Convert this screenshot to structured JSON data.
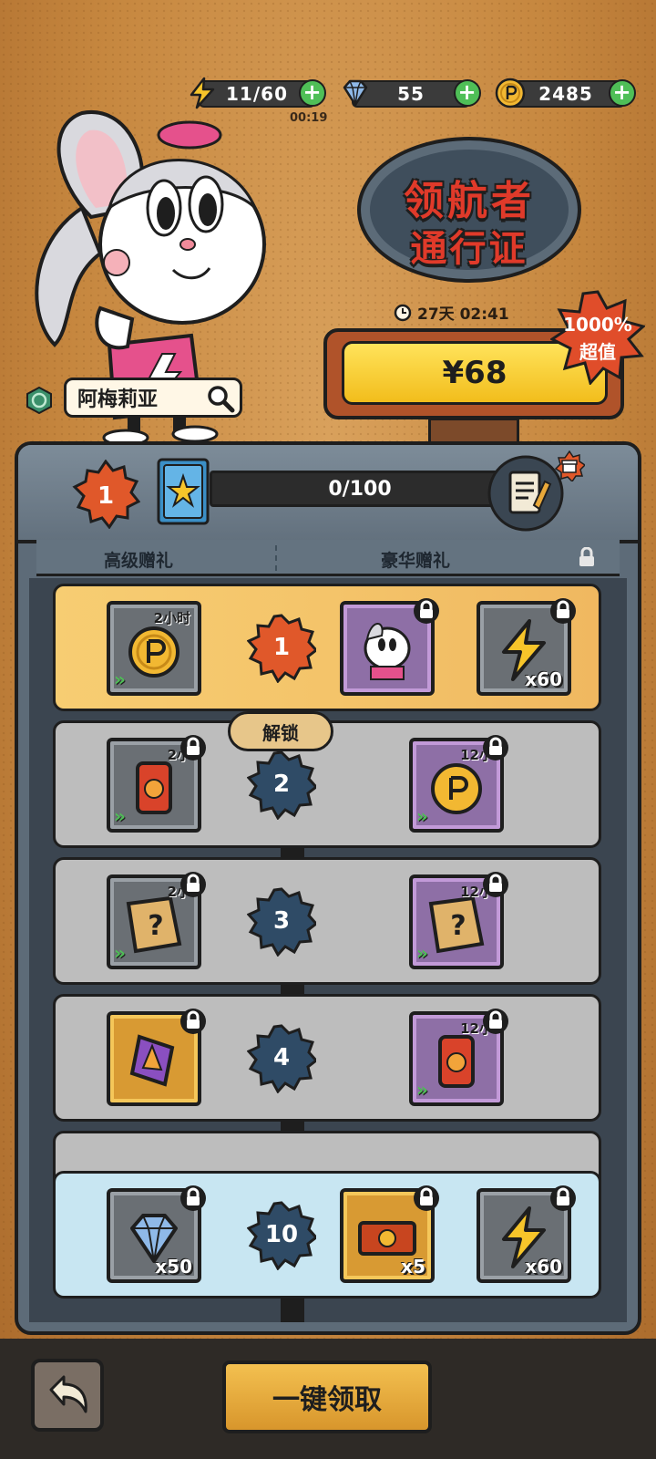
{
  "currencies": [
    {
      "name": "energy",
      "value": "11/60",
      "icon": "lightning-icon"
    },
    {
      "name": "gems",
      "value": "55",
      "icon": "diamond-icon"
    },
    {
      "name": "coins",
      "value": "2485",
      "icon": "coin-icon"
    }
  ],
  "energy_timer": "00:19",
  "character": {
    "name": "阿梅莉亚"
  },
  "title": {
    "line1": "领航者",
    "line2": "通行证"
  },
  "countdown": "27天 02:41",
  "price": "¥68",
  "value_badge": {
    "percent": "1000%",
    "label": "超值"
  },
  "pass": {
    "level": "1",
    "progress": "0/100"
  },
  "tabs": {
    "basic": "高级赠礼",
    "premium": "豪华赠礼"
  },
  "unlock_label": "解锁",
  "rows": [
    {
      "level": "1",
      "state": "active",
      "left": {
        "tag": "2小时",
        "qty": "",
        "icon": "coin-icon"
      },
      "mid": {
        "icon": "character-card-icon"
      },
      "right": {
        "qty": "x60",
        "icon": "lightning-icon"
      }
    },
    {
      "level": "2",
      "left": {
        "tag": "2小",
        "icon": "soda-can-icon"
      },
      "right": {
        "tag": "12小",
        "icon": "coin-icon"
      }
    },
    {
      "level": "3",
      "left": {
        "tag": "2小",
        "icon": "mystery-map-icon"
      },
      "right": {
        "tag": "12小",
        "icon": "mystery-map-icon"
      }
    },
    {
      "level": "4",
      "left": {
        "icon": "candy-pack-icon"
      },
      "right": {
        "tag": "12小",
        "icon": "soda-can-icon"
      }
    },
    {
      "level": "10",
      "left": {
        "qty": "x50",
        "icon": "diamond-icon"
      },
      "mid": {
        "qty": "x5",
        "icon": "ticket-icon"
      },
      "right": {
        "qty": "x60",
        "icon": "lightning-icon"
      }
    }
  ],
  "claim_button": "一键领取",
  "colors": {
    "accent_gold": "#f2bd1c",
    "title_red": "#e03a2a",
    "plus_green": "#4fbf57",
    "slate": "#5d6b78"
  }
}
